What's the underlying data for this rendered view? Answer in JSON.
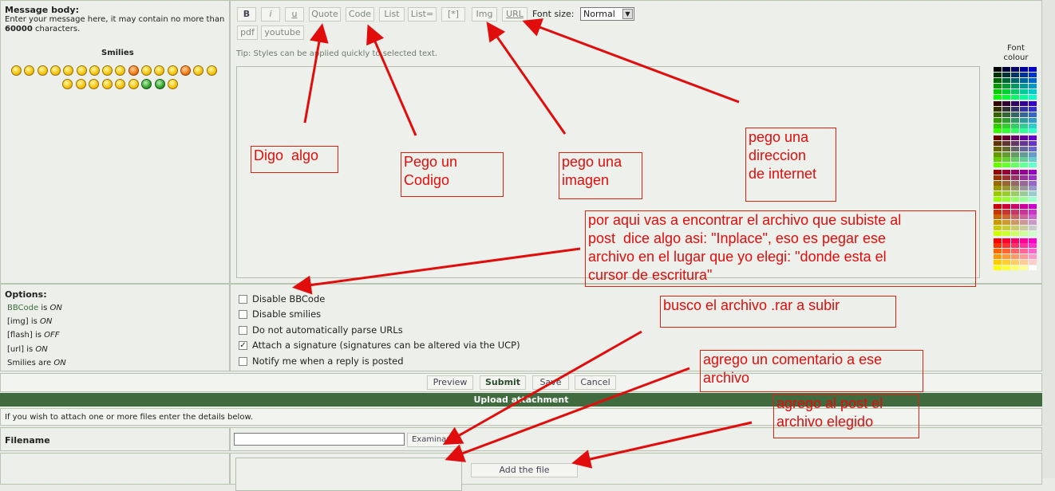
{
  "message_body": {
    "title": "Message body:",
    "description": "Enter your message here, it may contain no more than",
    "limit": "60000",
    "limit_suffix": "characters.",
    "smilies_title": "Smilies"
  },
  "toolbar": {
    "bold": "B",
    "italic": "i",
    "underline": "u",
    "quote": "Quote",
    "code": "Code",
    "list": "List",
    "list_eq": "List=",
    "list_item": "[*]",
    "img": "Img",
    "url": "URL",
    "font_size_label": "Font size:",
    "font_size_value": "Normal",
    "pdf": "pdf",
    "youtube": "youtube",
    "tip": "Tip: Styles can be applied quickly to selected text."
  },
  "font_colour": {
    "line1": "Font",
    "line2": "colour"
  },
  "options": {
    "title": "Options:",
    "bbcode_name": "BBCode",
    "bbcode_is": "is",
    "bbcode_state": "ON",
    "img_label": "[img] is",
    "img_state": "ON",
    "flash_label": "[flash] is",
    "flash_state": "OFF",
    "url_label": "[url] is",
    "url_state": "ON",
    "smilies_label": "Smilies are",
    "smilies_state": "ON",
    "checkboxes": [
      {
        "label": "Disable BBCode",
        "checked": false
      },
      {
        "label": "Disable smilies",
        "checked": false
      },
      {
        "label": "Do not automatically parse URLs",
        "checked": false
      },
      {
        "label": "Attach a signature (signatures can be altered via the UCP)",
        "checked": true
      },
      {
        "label": "Notify me when a reply is posted",
        "checked": false
      }
    ]
  },
  "actions": {
    "preview": "Preview",
    "submit": "Submit",
    "save": "Save",
    "cancel": "Cancel"
  },
  "upload": {
    "header": "Upload attachment",
    "info": "If you wish to attach one or more files enter the details below.",
    "filename_label": "Filename",
    "browse": "Examinar...",
    "add_file": "Add the file"
  },
  "annotations": {
    "quote": "Digo  algo",
    "code": "Pego un\nCodigo",
    "img": "pego una\nimagen",
    "url": "pego una\ndireccion\nde internet",
    "inplace": "por aqui vas a encontrar el archivo que subiste al\npost  dice algo asi: \"Inplace\", eso es pegar ese\narchivo en el lugar que yo elegi: \"donde esta el\ncursor de escritura\"",
    "browse": "busco el archivo .rar a subir",
    "comment": "agrego un comentario a ese\narchivo",
    "add": "agrego al post el\narchivo elegido"
  },
  "colors": {
    "annotation": "#e10d0d",
    "panel": "#edf0ea",
    "header_bar": "#3f6b3f"
  }
}
